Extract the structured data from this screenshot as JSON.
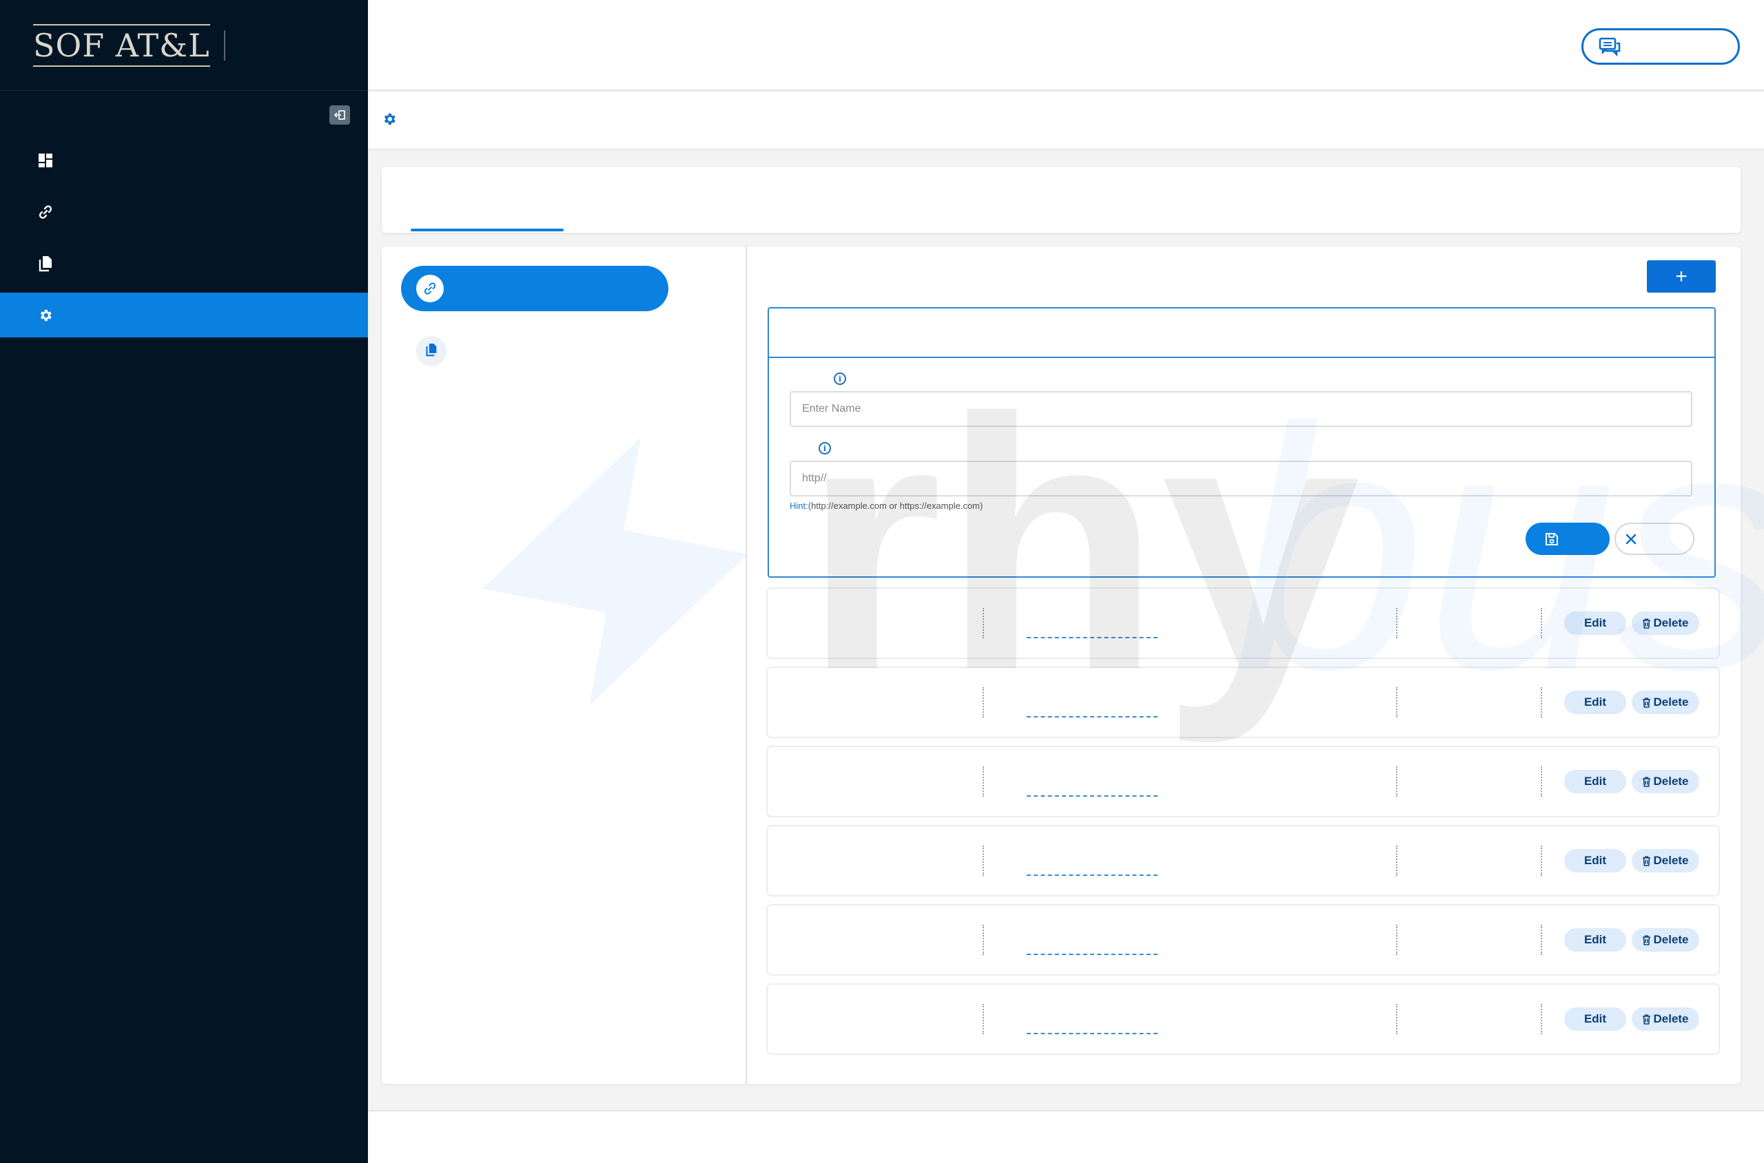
{
  "app": {
    "logo_text": "SOF AT&L"
  },
  "sidebar": {
    "collapse_icon": "collapse-icon",
    "items": [
      {
        "icon": "dashboard-icon",
        "label": "",
        "active": false
      },
      {
        "icon": "link-icon",
        "label": "",
        "active": false
      },
      {
        "icon": "documents-icon",
        "label": "",
        "active": false
      },
      {
        "icon": "gear-icon",
        "label": "",
        "active": true
      }
    ],
    "colors": {
      "background": "#031524",
      "active": "#0a80e0"
    }
  },
  "header": {
    "chat_button_icon": "chat-icon",
    "chat_button_label": ""
  },
  "subheader": {
    "icon": "gear-icon",
    "title": ""
  },
  "tabs": [
    {
      "label": "",
      "active": true
    }
  ],
  "left_panel": {
    "items": [
      {
        "icon": "link-icon",
        "label": "",
        "active": true
      },
      {
        "icon": "documents-icon",
        "label": "",
        "active": false
      }
    ]
  },
  "right_panel": {
    "add_button_label": "+",
    "form": {
      "title": "",
      "name_field": {
        "label": "",
        "placeholder": "Enter Name",
        "value": ""
      },
      "url_field": {
        "label": "",
        "placeholder": "http//",
        "value": ""
      },
      "hint_label": "Hint:",
      "hint_text": "(http://example.com or https://example.com)",
      "save_label": "",
      "cancel_label": ""
    },
    "rows": [
      {
        "name": "",
        "url": "",
        "type": "",
        "edit_label": "Edit",
        "delete_label": "Delete"
      },
      {
        "name": "",
        "url": "",
        "type": "",
        "edit_label": "Edit",
        "delete_label": "Delete"
      },
      {
        "name": "",
        "url": "",
        "type": "",
        "edit_label": "Edit",
        "delete_label": "Delete"
      },
      {
        "name": "",
        "url": "",
        "type": "",
        "edit_label": "Edit",
        "delete_label": "Delete"
      },
      {
        "name": "",
        "url": "",
        "type": "",
        "edit_label": "Edit",
        "delete_label": "Delete"
      },
      {
        "name": "",
        "url": "",
        "type": "",
        "edit_label": "Edit",
        "delete_label": "Delete"
      }
    ]
  },
  "watermark": {
    "word_bold": "rhy",
    "word_light": "bus"
  }
}
